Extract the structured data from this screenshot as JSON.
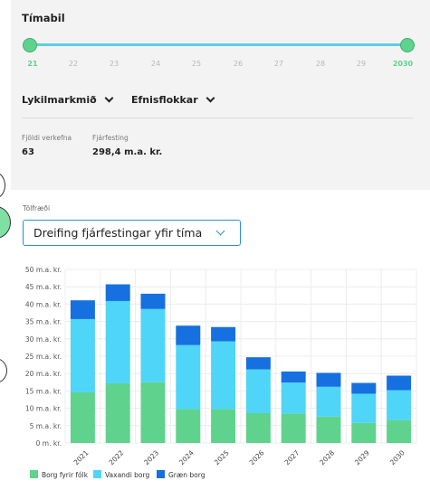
{
  "panel": {
    "title": "Tímabil",
    "timeline": {
      "ticks": [
        "21",
        "22",
        "23",
        "24",
        "25",
        "26",
        "27",
        "28",
        "29",
        "2030"
      ],
      "range_start": "21",
      "range_end": "2030"
    },
    "filters": [
      {
        "label": "Lykilmarkmið"
      },
      {
        "label": "Efnisflokkar"
      }
    ],
    "stats": [
      {
        "label": "Fjöldi verkefna",
        "value": "63"
      },
      {
        "label": "Fjárfesting",
        "value": "298,4 m.a. kr."
      }
    ]
  },
  "stats_section": {
    "label": "Tölfræði",
    "select_value": "Dreifing fjárfestingar yfir tíma"
  },
  "chart_data": {
    "type": "bar",
    "stacked": true,
    "categories": [
      "2021",
      "2022",
      "2023",
      "2024",
      "2025",
      "2026",
      "2027",
      "2028",
      "2029",
      "2030"
    ],
    "series": [
      {
        "name": "Borg fyrir fólk",
        "color": "#5fd38d",
        "values": [
          14.6,
          17.2,
          17.5,
          9.8,
          9.8,
          8.6,
          8.5,
          7.6,
          5.8,
          6.6
        ]
      },
      {
        "name": "Vaxandi borg",
        "color": "#4fd5f7",
        "values": [
          21.1,
          23.7,
          21.1,
          18.4,
          19.5,
          12.6,
          8.9,
          8.6,
          8.4,
          8.6
        ]
      },
      {
        "name": "Græn borg",
        "color": "#1670e0",
        "values": [
          5.4,
          4.8,
          4.4,
          5.6,
          4.1,
          3.5,
          3.2,
          4.0,
          3.1,
          4.2
        ]
      }
    ],
    "y_ticks": [
      "0 m. kr.",
      "5 m.a. kr.",
      "10 m.a. kr.",
      "15 m.a. kr.",
      "20 m.a. kr.",
      "25 m.a. kr.",
      "30 m.a. kr.",
      "35 m.a. kr.",
      "40 m.a. kr.",
      "45 m.a. kr.",
      "50 m.a. kr."
    ],
    "ylim": [
      0,
      50
    ],
    "grid": true,
    "legend": "bottom-left"
  }
}
